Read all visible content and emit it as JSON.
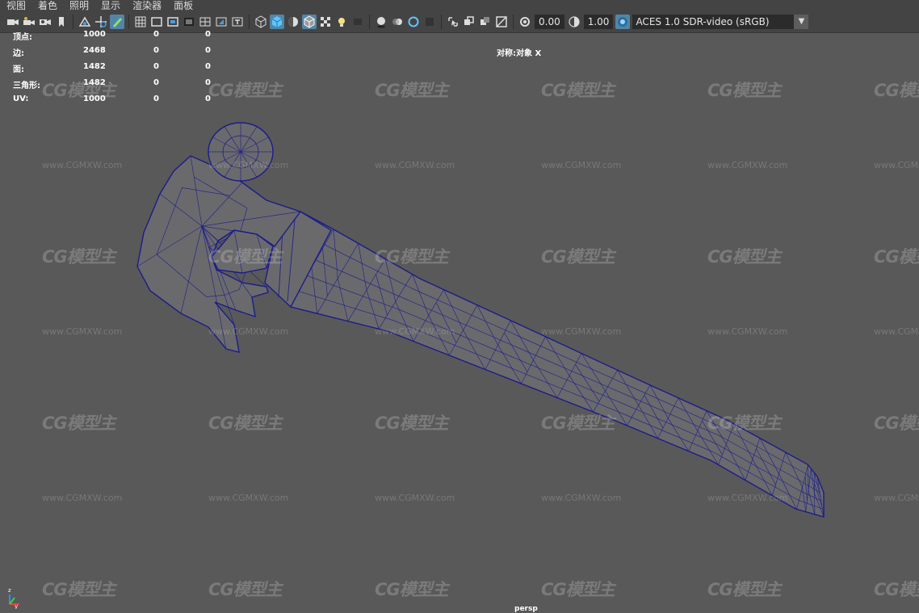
{
  "menu": {
    "items": [
      "视图",
      "着色",
      "照明",
      "显示",
      "渲染器",
      "面板"
    ]
  },
  "toolbar": {
    "icons": [
      "camera-icon",
      "camera-attributes-icon",
      "bookmark-camera-icon",
      "bookmark-icon",
      "image-plane-icon",
      "pan-zoom-icon",
      "grease-pencil-icon",
      "grid-icon",
      "film-gate-icon",
      "resolution-gate-icon",
      "gate-mask-icon",
      "field-chart-icon",
      "safe-action-icon",
      "safe-title-icon",
      "wireframe-icon",
      "smooth-shade-icon",
      "default-material-icon",
      "wireframe-on-shaded-icon",
      "textured-icon",
      "use-all-lights-icon",
      "shadows-icon",
      "screen-space-ao-icon",
      "motion-blur-icon",
      "multisample-aa-icon",
      "depth-of-field-icon",
      "isolate-select-icon",
      "xray-icon",
      "xray-joints-icon",
      "backface-culling-icon",
      "exposure-icon",
      "gamma-icon",
      "color-management-icon"
    ],
    "exposure_value": "0.00",
    "gamma_value": "1.00",
    "view_transform": "ACES 1.0 SDR-video (sRGB)"
  },
  "hud": {
    "rows": [
      {
        "label": "顶点:",
        "v1": "1000",
        "v2": "0",
        "v3": "0"
      },
      {
        "label": "边:",
        "v1": "2468",
        "v2": "0",
        "v3": "0"
      },
      {
        "label": "面:",
        "v1": "1482",
        "v2": "0",
        "v3": "0"
      },
      {
        "label": "三角形:",
        "v1": "1482",
        "v2": "0",
        "v3": "0"
      },
      {
        "label": "UV:",
        "v1": "1000",
        "v2": "0",
        "v3": "0"
      }
    ],
    "symmetry": "对称:对象 X",
    "camera": "persp"
  },
  "axis": {
    "y": "y",
    "z": "z"
  },
  "watermark": {
    "logo": "CG模型主",
    "url": "www.CGMXW.com"
  },
  "colors": {
    "viewport_bg": "#595959",
    "toolbar_bg": "#444444",
    "active_icon_bg": "#5285a6",
    "wire": "#1c1c8a",
    "mesh_fill": "#6a6a6d"
  }
}
